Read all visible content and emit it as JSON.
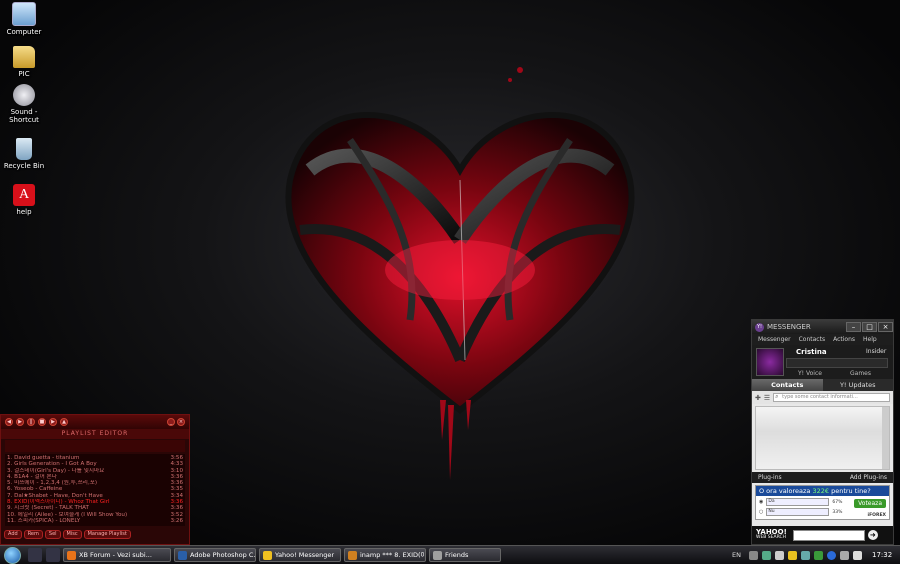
{
  "desktop": {
    "icons": [
      {
        "label": "Computer",
        "icon": "computer-icon",
        "color": "#9ec7ee"
      },
      {
        "label": "PIC",
        "icon": "folder-icon",
        "color": "#e8c25a"
      },
      {
        "label": "Sound - Shortcut",
        "icon": "sound-shortcut-icon",
        "color": "#c8c8d0"
      },
      {
        "label": "Recycle Bin",
        "icon": "recycle-bin-icon",
        "color": "#a8c8e0"
      },
      {
        "label": "help",
        "icon": "acrobat-icon",
        "color": "#d8101a"
      }
    ]
  },
  "winamp": {
    "title": "PLAYLIST EDITOR",
    "tracks": [
      {
        "title": "1. David guetta - titanium",
        "time": "3:56"
      },
      {
        "title": "2. Girls Generation - I Got A Boy",
        "time": "4:33"
      },
      {
        "title": "3. 걸스데이(Girl's Day) - 나를 잊지마요",
        "time": "3:10"
      },
      {
        "title": "4. B1A4 - 걸어 본다",
        "time": "3:36"
      },
      {
        "title": "5. 미쓰에이 - 1,2,3,4 (원,투,쓰리,포)",
        "time": "3:36"
      },
      {
        "title": "6. Yoseob - Caffeine",
        "time": "3:35"
      },
      {
        "title": "7. Dal★Shabet - Have, Don't Have",
        "time": "3:34"
      },
      {
        "title": "8. EXID(이엑스아이디) - Whoz That Girl",
        "time": "3:36"
      },
      {
        "title": "9. 시크릿 (Secret) - TALK THAT",
        "time": "3:36"
      },
      {
        "title": "10. 에일리 (Ailee) - 보여줄게 (I Will Show You)",
        "time": "3:52"
      },
      {
        "title": "11. 스피카(SPICA) - LONELY",
        "time": "3:26"
      }
    ],
    "current_index": 7,
    "buttons": [
      "Add",
      "Rem",
      "Sel",
      "Misc",
      "Manage Playlist"
    ]
  },
  "messenger": {
    "title": "MESSENGER",
    "menu": [
      "Messenger",
      "Contacts",
      "Actions",
      "Help"
    ],
    "user_name": "Cristina",
    "insider_label": "Insider",
    "voice_label": "Y! Voice",
    "games_label": "Games",
    "tabs": [
      "Contacts",
      "Y! Updates"
    ],
    "search_placeholder": "type some contact informati...",
    "plugins_label": "Plug-ins",
    "add_plugins_label": "Add Plug-ins",
    "ad": {
      "question_prefix": "O ora valoreaza ",
      "amount": "322€",
      "question_suffix": " pentru tine?",
      "options": [
        {
          "label": "Da",
          "pct": "67%"
        },
        {
          "label": "Nu",
          "pct": "33%"
        }
      ],
      "vote_label": "Voteaza",
      "brand": "iFOREX"
    },
    "web_search": {
      "logo": "YAHOO!",
      "sub": "WEB SEARCH"
    }
  },
  "taskbar": {
    "tasks": [
      {
        "label": "XB Forum - Vezi subi...",
        "color": "#e8731a"
      },
      {
        "label": "Adobe Photoshop C...",
        "color": "#2a5fa8"
      },
      {
        "label": "Yahoo! Messenger",
        "color": "#f0c020"
      },
      {
        "label": "inamp *** 8. EXID(이...",
        "color": "#d08020"
      },
      {
        "label": "Friends",
        "color": "#a0a0a0"
      }
    ],
    "language": "EN",
    "clock": "17:32"
  }
}
